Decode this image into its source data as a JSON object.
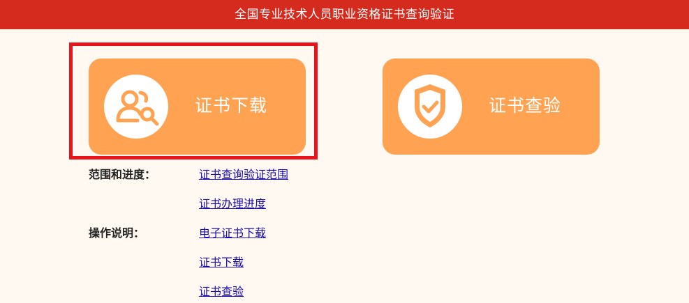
{
  "header": {
    "title": "全国专业技术人员职业资格证书查询验证"
  },
  "tiles": {
    "download": {
      "label": "证书下载",
      "icon": "user-search-icon"
    },
    "verify": {
      "label": "证书查验",
      "icon": "shield-check-icon"
    }
  },
  "info": {
    "scope_label": "范围和进度：",
    "scope_links": [
      "证书查询验证范围",
      "证书办理进度"
    ],
    "guide_label": "操作说明：",
    "guide_links": [
      "电子证书下载",
      "证书下载",
      "证书查验"
    ]
  },
  "colors": {
    "header_bg": "#d52b1e",
    "tile_bg": "#ffa352",
    "highlight": "#e8131b",
    "link": "#1a0dab",
    "page_bg": "#fff9f1"
  }
}
